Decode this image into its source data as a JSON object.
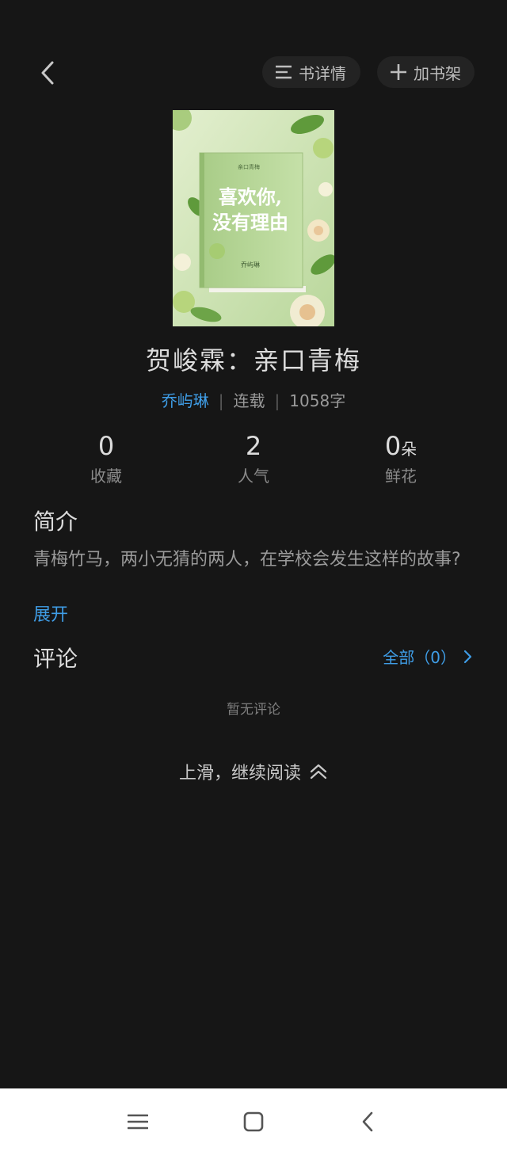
{
  "header": {
    "detail_label": "书详情",
    "add_shelf_label": "加书架"
  },
  "book": {
    "cover": {
      "title_line1": "喜欢你,",
      "title_line2": "没有理由",
      "small_title": "亲口青梅",
      "author_small": "乔屿琳"
    },
    "title": "贺峻霖：亲口青梅",
    "author": "乔屿琳",
    "status": "连载",
    "word_count": "1058字",
    "separator": "|"
  },
  "stats": [
    {
      "value": "0",
      "unit": "",
      "label": "收藏"
    },
    {
      "value": "2",
      "unit": "",
      "label": "人气"
    },
    {
      "value": "0",
      "unit": "朵",
      "label": "鲜花"
    }
  ],
  "intro": {
    "heading": "简介",
    "text": "青梅竹马，两小无猜的两人，在学校会发生这样的故事?",
    "expand": "展开"
  },
  "comments": {
    "heading": "评论",
    "all_label": "全部（0）",
    "empty_text": "暂无评论"
  },
  "continue_label": "上滑，继续阅读",
  "colors": {
    "background": "#161616",
    "accent": "#3f9de6",
    "nav_background": "#ffffff"
  },
  "icons": [
    "back-icon",
    "list-icon",
    "plus-icon",
    "chevron-right-icon",
    "double-chevron-up-icon",
    "menu-icon",
    "home-icon",
    "nav-back-icon"
  ]
}
